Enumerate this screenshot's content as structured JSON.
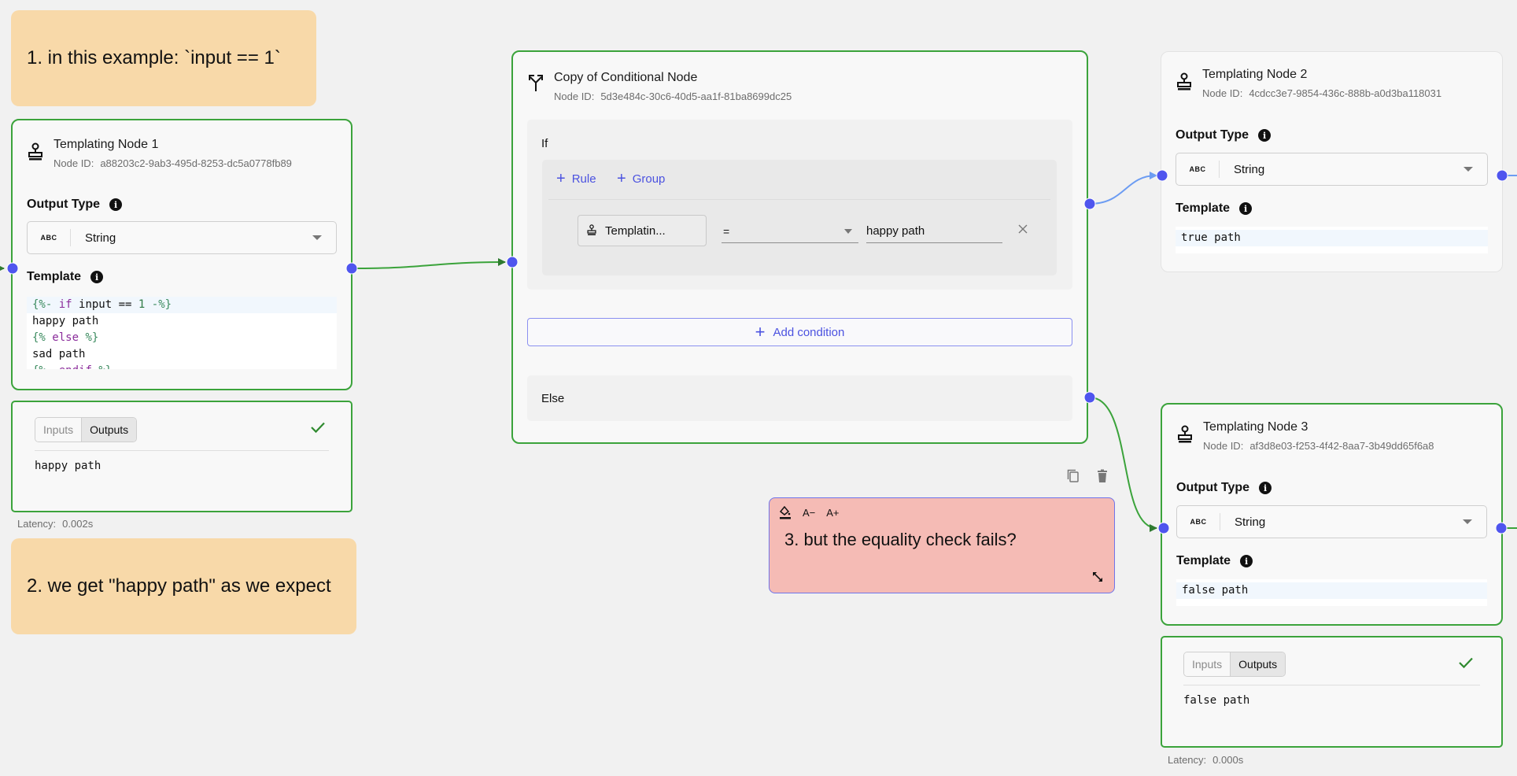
{
  "notes": [
    {
      "text": "1. in this example: `input == 1`",
      "color": "#f8d9a9"
    },
    {
      "text": "2. we get \"happy path\" as we expect",
      "color": "#f8d9a9"
    },
    {
      "text": "3. but the equality check fails?",
      "color": "#f5bbb5",
      "toolbar": {
        "paint_icon": "paint-bucket-icon",
        "decrease_label": "A−",
        "increase_label": "A+"
      },
      "resize_icon": "resize-diagonal-icon"
    }
  ],
  "note_actions": {
    "copy_icon": "copy-icon",
    "delete_icon": "trash-icon"
  },
  "common": {
    "node_id_label": "Node ID:",
    "output_type_label": "Output Type",
    "template_label": "Template",
    "type_badge": "ABC",
    "latency_label": "Latency:",
    "inputs_tab": "Inputs",
    "outputs_tab": "Outputs"
  },
  "templating_node_1": {
    "title": "Templating Node 1",
    "node_id": "a88203c2-9ab3-495d-8253-dc5a0778fb89",
    "output_type": "String",
    "template_lines": [
      "{%- if input == 1 -%}",
      "happy path",
      "{% else %}",
      "sad path",
      "{%- endif %}"
    ],
    "output": "happy path",
    "status": "success",
    "latency": "0.002s",
    "active_tab": "Outputs"
  },
  "conditional_node": {
    "title": "Copy of Conditional Node",
    "node_id": "5d3e484c-30c6-40d5-aa1f-81ba8699dc25",
    "if_label": "If",
    "add_rule_label": "Rule",
    "add_group_label": "Group",
    "rule": {
      "field": "Templatin...",
      "operator": "=",
      "value": "happy path"
    },
    "add_condition_label": "Add condition",
    "else_label": "Else"
  },
  "templating_node_2": {
    "title": "Templating Node 2",
    "node_id": "4cdcc3e7-9854-436c-888b-a0d3ba118031",
    "output_type": "String",
    "template_lines": [
      "true path"
    ]
  },
  "templating_node_3": {
    "title": "Templating Node 3",
    "node_id": "af3d8e03-f253-4f42-8aa7-3b49dd65f6a8",
    "output_type": "String",
    "template_lines": [
      "false path"
    ],
    "output": "false path",
    "status": "success",
    "latency": "0.000s",
    "active_tab": "Outputs"
  },
  "colors": {
    "edge_executed": "#3ba33b",
    "edge_default": "#6c9cf2",
    "handle": "#4f55ee",
    "accent": "#4b52e0",
    "canvas": "#f1f1f1"
  }
}
